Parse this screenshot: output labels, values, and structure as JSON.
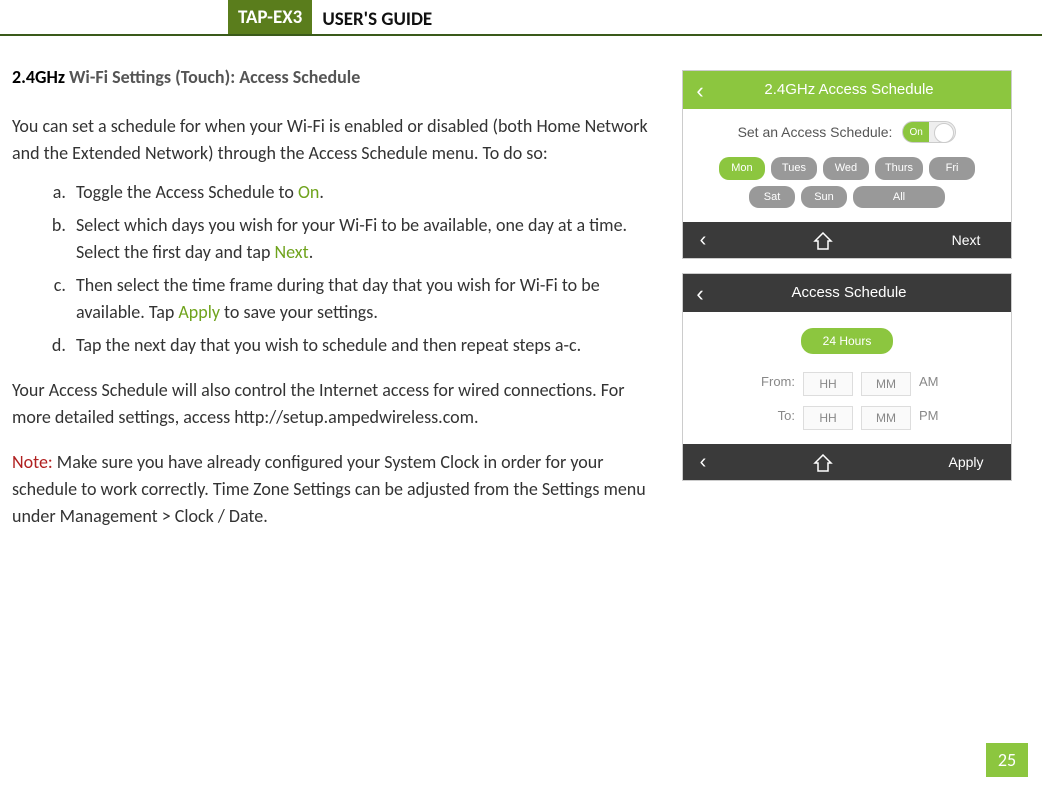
{
  "header": {
    "model": "TAP-EX3",
    "guide": "USER'S GUIDE"
  },
  "section": {
    "ghz_prefix": "2.4GHz",
    "title_rest": " Wi-Fi Settings (Touch): Access Schedule"
  },
  "intro": "You can set a schedule for when your Wi-Fi is enabled or disabled (both Home Network and the Extended Network) through the Access Schedule menu. To do so:",
  "steps": {
    "a_pre": "Toggle the Access Schedule to ",
    "a_on": "On",
    "a_post": ".",
    "b_pre": "Select which days you wish for your Wi-Fi to be available, one day at a time. Select the first day and tap ",
    "b_next": "Next",
    "b_post": ".",
    "c_pre": "Then select the time frame during that day that you wish for Wi-Fi to be available. Tap ",
    "c_apply": "Apply",
    "c_post": " to save your settings.",
    "d": "Tap the next day that you wish to schedule and then repeat steps a-c."
  },
  "after": "Your Access Schedule will also control the Internet access for wired connections. For more detailed settings, access http://setup.ampedwireless.com.",
  "note": {
    "label": "Note:",
    "text": "  Make sure you have already configured your System Clock in order for your schedule to work correctly. Time Zone Settings can be adjusted from the Settings menu under Management > Clock / Date."
  },
  "fig1": {
    "title": "2.4GHz Access Schedule",
    "set_label": "Set an Access Schedule:",
    "toggle": "On",
    "days": [
      "Mon",
      "Tues",
      "Wed",
      "Thurs",
      "Fri",
      "Sat",
      "Sun",
      "All"
    ],
    "active_day_index": 0,
    "footer_action": "Next"
  },
  "fig2": {
    "title": "Access Schedule",
    "hours_badge": "24 Hours",
    "from_label": "From:",
    "to_label": "To:",
    "hh": "HH",
    "mm": "MM",
    "am": "AM",
    "pm": "PM",
    "footer_action": "Apply"
  },
  "page_number": "25"
}
